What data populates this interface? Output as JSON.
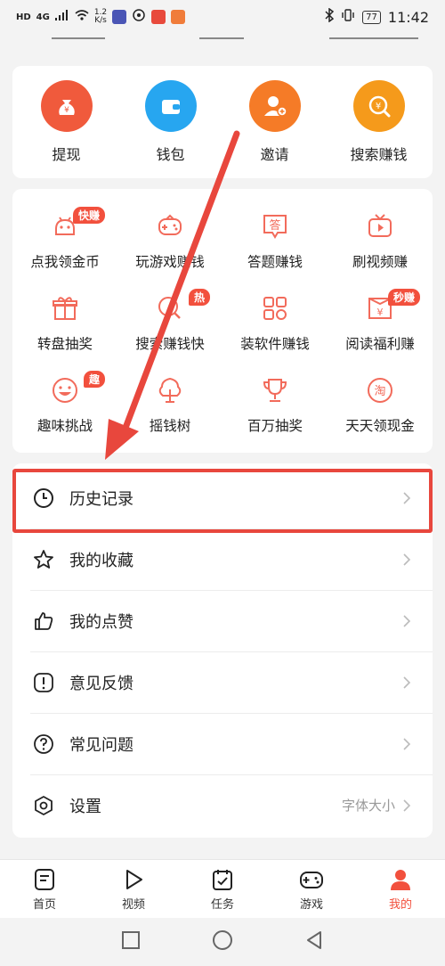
{
  "status_bar": {
    "left": [
      "HD",
      "4G",
      "1.2",
      "K/s"
    ],
    "battery": "77",
    "time": "11:42"
  },
  "top_actions": [
    {
      "label": "提现",
      "icon": "money-bag-icon",
      "color": "#f05a3c"
    },
    {
      "label": "钱包",
      "icon": "wallet-icon",
      "color": "#27a6f0"
    },
    {
      "label": "邀请",
      "icon": "invite-user-icon",
      "color": "#f57b27"
    },
    {
      "label": "搜索赚钱",
      "icon": "search-coin-icon",
      "color": "#f59a1b"
    }
  ],
  "grid_items": [
    {
      "label": "点我领金币",
      "icon": "android-robot-icon",
      "badge": "快赚"
    },
    {
      "label": "玩游戏赚钱",
      "icon": "gamepad-icon",
      "badge": ""
    },
    {
      "label": "答题赚钱",
      "icon": "quiz-answer-icon",
      "badge": ""
    },
    {
      "label": "刷视频赚",
      "icon": "tv-play-icon",
      "badge": ""
    },
    {
      "label": "转盘抽奖",
      "icon": "gift-box-icon",
      "badge": ""
    },
    {
      "label": "搜索赚钱快",
      "icon": "search-coin-icon",
      "badge": "热"
    },
    {
      "label": "装软件赚钱",
      "icon": "apps-grid-icon",
      "badge": ""
    },
    {
      "label": "阅读福利赚",
      "icon": "book-coin-icon",
      "badge": "秒赚"
    },
    {
      "label": "趣味挑战",
      "icon": "smiley-icon",
      "badge": "趣"
    },
    {
      "label": "摇钱树",
      "icon": "money-tree-icon",
      "badge": ""
    },
    {
      "label": "百万抽奖",
      "icon": "trophy-icon",
      "badge": ""
    },
    {
      "label": "天天领现金",
      "icon": "taobao-coin-icon",
      "badge": ""
    }
  ],
  "list_rows": [
    {
      "label": "历史记录",
      "icon": "clock-icon",
      "extra": ""
    },
    {
      "label": "我的收藏",
      "icon": "star-icon",
      "extra": ""
    },
    {
      "label": "我的点赞",
      "icon": "thumbs-up-icon",
      "extra": ""
    },
    {
      "label": "意见反馈",
      "icon": "feedback-icon",
      "extra": ""
    },
    {
      "label": "常见问题",
      "icon": "question-icon",
      "extra": ""
    },
    {
      "label": "设置",
      "icon": "settings-hexagon-icon",
      "extra": "字体大小"
    }
  ],
  "bottom_nav": [
    {
      "label": "首页",
      "icon": "home-doc-icon",
      "active": false
    },
    {
      "label": "视频",
      "icon": "play-icon",
      "active": false
    },
    {
      "label": "任务",
      "icon": "task-calendar-icon",
      "active": false
    },
    {
      "label": "游戏",
      "icon": "gamepad-icon",
      "active": false
    },
    {
      "label": "我的",
      "icon": "profile-icon",
      "active": true
    }
  ],
  "colors": {
    "accent": "#f2503d",
    "annotation": "#e8473d"
  }
}
